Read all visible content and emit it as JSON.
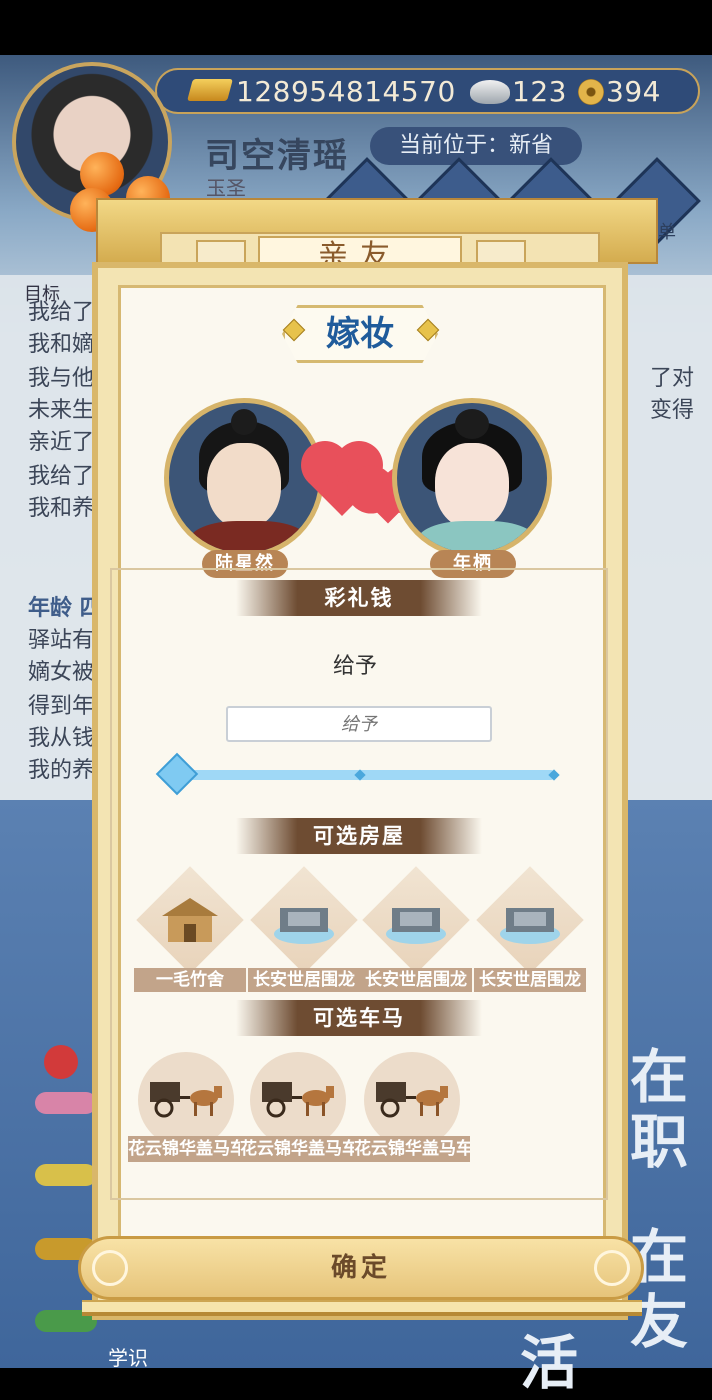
{
  "resources": {
    "gold": "128954814570",
    "silver": "123",
    "coins": "394"
  },
  "character": {
    "name": "司空清瑶",
    "location": "当前位于：新省",
    "title": "玉圣"
  },
  "background": {
    "goal_label": "目标",
    "lines": [
      "我给了",
      "我和嫡",
      "我与他",
      "未来生",
      "亲近了",
      "我给了",
      "我和养"
    ],
    "right_lines": [
      "了对",
      "变得"
    ],
    "age_label": "年龄 四",
    "lines2": [
      "驿站有",
      "嫡女被",
      "得到年",
      "我从钱",
      "我的养"
    ],
    "menu_label": "菜单",
    "big_glyphs": [
      "在",
      "职",
      "在",
      "友",
      "活"
    ],
    "bottom_label": "学识"
  },
  "dialog": {
    "title": "亲友",
    "subtitle": "嫁妆",
    "groom_name": "陆星然",
    "bride_name": "年栖",
    "betrothal_section": "彩礼钱",
    "give_label": "给予",
    "give_placeholder": "给予",
    "slider_value": 0,
    "house_section": "可选房屋",
    "houses": [
      "一毛竹舍",
      "长安世居围龙",
      "长安世居围龙",
      "长安世居围龙"
    ],
    "carriage_section": "可选车马",
    "carriages": [
      "花云锦华盖马车",
      "花云锦华盖马车",
      "花云锦华盖马车"
    ],
    "confirm_label": "确定"
  }
}
